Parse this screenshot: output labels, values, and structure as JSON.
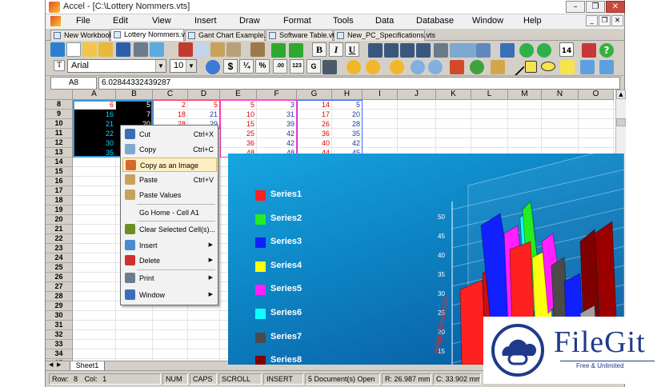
{
  "window": {
    "title": "Accel - [C:\\Lottery Nommers.vts]",
    "controls": {
      "minimize": "–",
      "restore": "❐",
      "close": "✕"
    }
  },
  "menubar": [
    "File",
    "Edit",
    "View",
    "Insert",
    "Draw",
    "Format",
    "Tools",
    "Data",
    "Database",
    "Window",
    "Help"
  ],
  "doc_tabs": [
    {
      "label": "New Workbook",
      "active": false
    },
    {
      "label": "Lottery Nommers.vts",
      "active": true
    },
    {
      "label": "Gant Chart Example.vts",
      "active": false
    },
    {
      "label": "Software Table.vts",
      "active": false
    },
    {
      "label": "New_PC_Specifications.vts",
      "active": false
    }
  ],
  "formatting": {
    "font_name": "Arial",
    "font_size": "10",
    "bold": "B",
    "italic": "I",
    "underline": "U",
    "buttons": [
      "$",
      "¼",
      "%",
      ".00",
      "123",
      "G"
    ],
    "date_badge": "14"
  },
  "formula_bar": {
    "cell_ref": "A8",
    "value": "6.02844332439287"
  },
  "grid": {
    "columns": [
      "A",
      "B",
      "C",
      "D",
      "E",
      "F",
      "G",
      "H",
      "I",
      "J",
      "K",
      "L",
      "M",
      "N",
      "O"
    ],
    "rows": [
      "8",
      "9",
      "10",
      "11",
      "12",
      "13",
      "14",
      "15",
      "16",
      "17",
      "18",
      "19",
      "20",
      "21",
      "22",
      "23",
      "24",
      "25",
      "26",
      "27",
      "28",
      "29",
      "30",
      "31",
      "32",
      "33",
      "34",
      "35"
    ],
    "cells": [
      {
        "ref": "A8",
        "v": "6",
        "c": "#e00000"
      },
      {
        "ref": "B8",
        "v": "5",
        "c": "#ffffff"
      },
      {
        "ref": "C8",
        "v": "2",
        "c": "#e00000"
      },
      {
        "ref": "D8",
        "v": "5",
        "c": "#e00000"
      },
      {
        "ref": "E8",
        "v": "5",
        "c": "#e00000"
      },
      {
        "ref": "F8",
        "v": "3",
        "c": "#1a3aa0"
      },
      {
        "ref": "G8",
        "v": "14",
        "c": "#e00000"
      },
      {
        "ref": "H8",
        "v": "5",
        "c": "#1a3aa0"
      },
      {
        "ref": "A9",
        "v": "16",
        "c": "#00d8ff"
      },
      {
        "ref": "B9",
        "v": "7",
        "c": "#ffffff"
      },
      {
        "ref": "C9",
        "v": "18",
        "c": "#e00000"
      },
      {
        "ref": "D9",
        "v": "21",
        "c": "#1a3aa0"
      },
      {
        "ref": "E9",
        "v": "10",
        "c": "#e00000"
      },
      {
        "ref": "F9",
        "v": "31",
        "c": "#1a3aa0"
      },
      {
        "ref": "G9",
        "v": "17",
        "c": "#e00000"
      },
      {
        "ref": "H9",
        "v": "20",
        "c": "#1a3aa0"
      },
      {
        "ref": "A10",
        "v": "21",
        "c": "#00d8ff"
      },
      {
        "ref": "B10",
        "v": "20",
        "c": "#ffffff"
      },
      {
        "ref": "C10",
        "v": "28",
        "c": "#e00000"
      },
      {
        "ref": "D10",
        "v": "29",
        "c": "#1a3aa0"
      },
      {
        "ref": "E10",
        "v": "15",
        "c": "#e00000"
      },
      {
        "ref": "F10",
        "v": "39",
        "c": "#1a3aa0"
      },
      {
        "ref": "G10",
        "v": "26",
        "c": "#e00000"
      },
      {
        "ref": "H10",
        "v": "28",
        "c": "#1a3aa0"
      },
      {
        "ref": "A11",
        "v": "22",
        "c": "#00d8ff"
      },
      {
        "ref": "E11",
        "v": "25",
        "c": "#e00000"
      },
      {
        "ref": "F11",
        "v": "42",
        "c": "#1a3aa0"
      },
      {
        "ref": "G11",
        "v": "36",
        "c": "#e00000"
      },
      {
        "ref": "H11",
        "v": "35",
        "c": "#1a3aa0"
      },
      {
        "ref": "A12",
        "v": "30",
        "c": "#00d8ff"
      },
      {
        "ref": "E12",
        "v": "36",
        "c": "#e00000"
      },
      {
        "ref": "F12",
        "v": "42",
        "c": "#1a3aa0"
      },
      {
        "ref": "G12",
        "v": "40",
        "c": "#e00000"
      },
      {
        "ref": "H12",
        "v": "42",
        "c": "#1a3aa0"
      },
      {
        "ref": "A13",
        "v": "35",
        "c": "#00d8ff"
      },
      {
        "ref": "E13",
        "v": "48",
        "c": "#e00000"
      },
      {
        "ref": "F13",
        "v": "48",
        "c": "#1a3aa0"
      },
      {
        "ref": "G13",
        "v": "44",
        "c": "#e00000"
      },
      {
        "ref": "H13",
        "v": "45",
        "c": "#1a3aa0"
      }
    ]
  },
  "context_menu": [
    {
      "label": "Cut",
      "shortcut": "Ctrl+X",
      "icon": "scissors-icon",
      "highlight": false,
      "submenu": false
    },
    {
      "label": "Copy",
      "shortcut": "Ctrl+C",
      "icon": "copy-icon",
      "highlight": false,
      "submenu": false
    },
    {
      "label": "Copy as an Image",
      "shortcut": "",
      "icon": "copy-image-icon",
      "highlight": true,
      "submenu": false
    },
    {
      "label": "Paste",
      "shortcut": "Ctrl+V",
      "icon": "paste-icon",
      "highlight": false,
      "submenu": false
    },
    {
      "label": "Paste Values",
      "shortcut": "",
      "icon": "paste-values-icon",
      "highlight": false,
      "submenu": false
    },
    {
      "label": "Go Home - Cell A1",
      "shortcut": "",
      "icon": "",
      "highlight": false,
      "submenu": false
    },
    {
      "label": "Clear Selected Cell(s)...",
      "shortcut": "",
      "icon": "eraser-icon",
      "highlight": false,
      "submenu": false
    },
    {
      "label": "Insert",
      "shortcut": "",
      "icon": "insert-icon",
      "highlight": false,
      "submenu": true
    },
    {
      "label": "Delete",
      "shortcut": "",
      "icon": "delete-icon",
      "highlight": false,
      "submenu": true
    },
    {
      "label": "Print",
      "shortcut": "",
      "icon": "printer-icon",
      "highlight": false,
      "submenu": true
    },
    {
      "label": "Window",
      "shortcut": "",
      "icon": "window-icon",
      "highlight": false,
      "submenu": true
    }
  ],
  "chart": {
    "legend": [
      {
        "name": "Series1",
        "color": "#ff2020"
      },
      {
        "name": "Series2",
        "color": "#22ee22"
      },
      {
        "name": "Series3",
        "color": "#1020ff"
      },
      {
        "name": "Series4",
        "color": "#ffff10"
      },
      {
        "name": "Series5",
        "color": "#ff20ff"
      },
      {
        "name": "Series6",
        "color": "#10ffff"
      },
      {
        "name": "Series7",
        "color": "#4a4a4a"
      },
      {
        "name": "Series8",
        "color": "#800000"
      }
    ],
    "axis_label": "erage Deviation",
    "axis_ticks": [
      "50",
      "45",
      "40",
      "35",
      "30",
      "25",
      "20",
      "15"
    ]
  },
  "sheet_tab": "Sheet1",
  "status": {
    "row": "Row:",
    "row_value": "8",
    "col": "Col:",
    "col_value": "1",
    "num": "NUM",
    "caps": "CAPS",
    "scroll": "SCROLL",
    "insert": "INSERT",
    "documents": "5 Document(s) Open",
    "r": "R: 26.987 mm",
    "c": "C: 33.902 mm"
  },
  "watermark": {
    "brand": "FileGit",
    "tagline": "Free & Unlimited"
  }
}
